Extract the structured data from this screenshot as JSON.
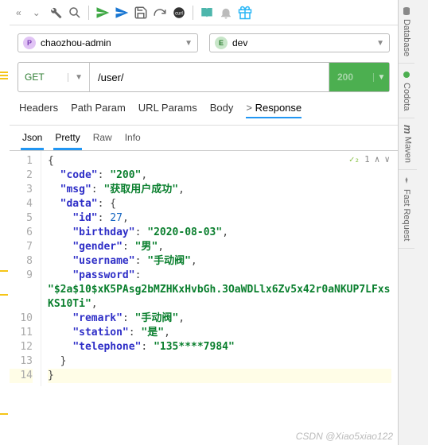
{
  "sidebar_right": [
    {
      "label": "Database",
      "icon": "database-icon"
    },
    {
      "label": "Codota",
      "icon": "codota-icon"
    },
    {
      "label": "Maven",
      "icon": "maven-icon",
      "italic": true,
      "symbol": "m"
    },
    {
      "label": "Fast Request",
      "icon": "rocket-icon"
    }
  ],
  "toolbar": {
    "icons": [
      "wrench",
      "search",
      "send",
      "send",
      "save",
      "redo",
      "curl",
      "book",
      "bell",
      "gift"
    ]
  },
  "project_selector": {
    "badge": "P",
    "value": "chaozhou-admin"
  },
  "env_selector": {
    "badge": "E",
    "value": "dev"
  },
  "request": {
    "method": "GET",
    "url": "/user/",
    "status": "200"
  },
  "tabs": [
    "Headers",
    "Path Param",
    "URL Params",
    "Body",
    "Response"
  ],
  "active_tab": "Response",
  "sub_tabs": [
    "Json",
    "Pretty",
    "Raw",
    "Info"
  ],
  "editor_badge": {
    "count": "1"
  },
  "response_json": {
    "code": "200",
    "msg": "获取用户成功",
    "data": {
      "id": 27,
      "birthday": "2020-08-03",
      "gender": "男",
      "username": "手动阀",
      "password": "$2a$10$xK5PAsg2bMZHKxHvbGh.3OaWDLlx6Zv5x42r0aNKUP7LFxsKS10Ti",
      "remark": "手动阀",
      "station": "是",
      "telephone": "135****7984"
    }
  },
  "lines": [
    "1",
    "2",
    "3",
    "4",
    "5",
    "6",
    "7",
    "8",
    "9",
    "10",
    "11",
    "12",
    "13",
    "14"
  ],
  "watermark": "CSDN @Xiao5xiao122"
}
